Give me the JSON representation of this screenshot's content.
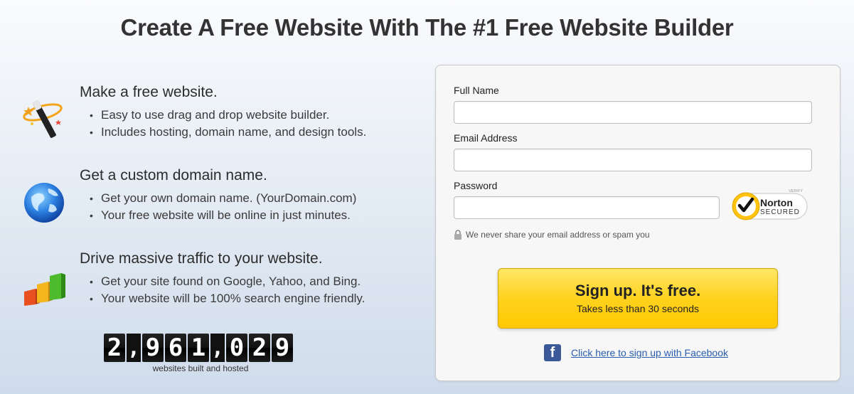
{
  "headline": "Create A Free Website With The #1 Free Website Builder",
  "features": [
    {
      "icon": "magic-wand-icon",
      "title": "Make a free website.",
      "bullets": [
        "Easy to use drag and drop website builder.",
        "Includes hosting, domain name, and design tools."
      ]
    },
    {
      "icon": "globe-icon",
      "title": "Get a custom domain name.",
      "bullets": [
        "Get your own domain name. (YourDomain.com)",
        "Your free website will be online in just minutes."
      ]
    },
    {
      "icon": "bar-chart-icon",
      "title": "Drive massive traffic to your website.",
      "bullets": [
        "Get your site found on Google, Yahoo, and Bing.",
        "Your website will be 100% search engine friendly."
      ]
    }
  ],
  "counter": {
    "value": "2,961,029",
    "chars": [
      "2",
      ",",
      "9",
      "6",
      "1",
      ",",
      "0",
      "2",
      "9"
    ],
    "label": "websites built and hosted"
  },
  "form": {
    "full_name_label": "Full Name",
    "full_name_value": "",
    "email_label": "Email Address",
    "email_value": "",
    "password_label": "Password",
    "password_value": "",
    "privacy_note": "We never share your email address or spam you",
    "norton": {
      "verify": "VERIFY",
      "name": "Norton",
      "secured": "SECURED"
    },
    "signup_main": "Sign up. It's free.",
    "signup_sub": "Takes less than 30 seconds",
    "facebook_link": "Click here to sign up with Facebook"
  },
  "colors": {
    "accent_yellow": "#ffd21f",
    "facebook_blue": "#3b5998",
    "link": "#2a5db0"
  }
}
